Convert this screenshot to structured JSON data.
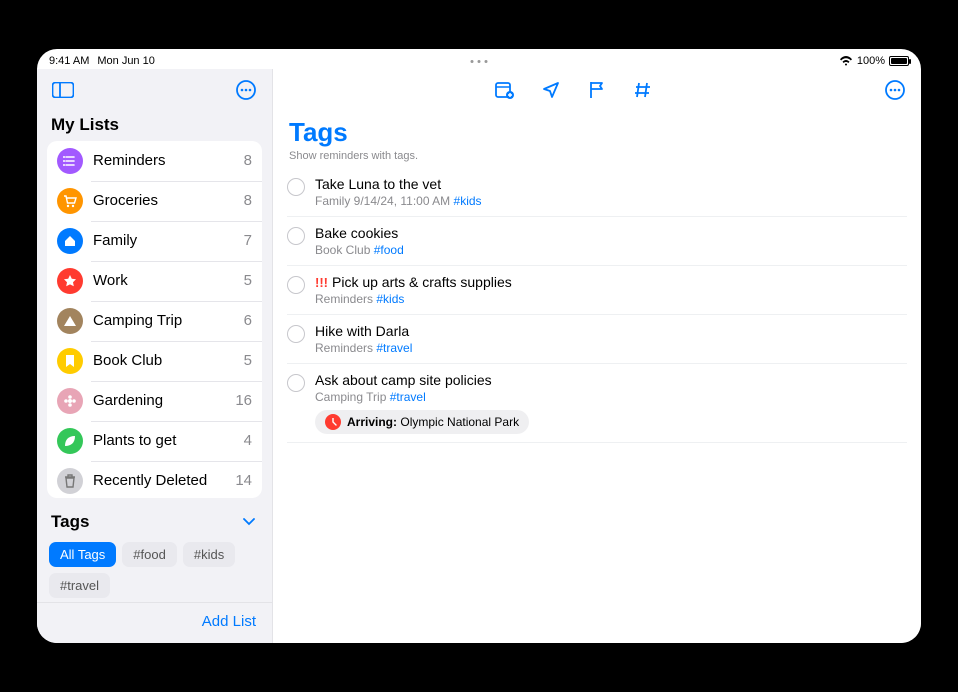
{
  "status": {
    "time": "9:41 AM",
    "date": "Mon Jun 10",
    "battery_pct": "100%"
  },
  "sidebar": {
    "my_lists_title": "My Lists",
    "lists": [
      {
        "name": "Reminders",
        "count": 8,
        "color": "#a259ff",
        "icon": "list"
      },
      {
        "name": "Groceries",
        "count": 8,
        "color": "#ff9500",
        "icon": "cart"
      },
      {
        "name": "Family",
        "count": 7,
        "color": "#007aff",
        "icon": "home"
      },
      {
        "name": "Work",
        "count": 5,
        "color": "#ff3b30",
        "icon": "star"
      },
      {
        "name": "Camping Trip",
        "count": 6,
        "color": "#a2845e",
        "icon": "tent"
      },
      {
        "name": "Book Club",
        "count": 5,
        "color": "#ffcc00",
        "icon": "bookmark"
      },
      {
        "name": "Gardening",
        "count": 16,
        "color": "#e8a5b6",
        "icon": "flower"
      },
      {
        "name": "Plants to get",
        "count": 4,
        "color": "#34c759",
        "icon": "leaf"
      },
      {
        "name": "Recently Deleted",
        "count": 14,
        "color": "#d1d1d6",
        "icon": "trash"
      }
    ],
    "tags_title": "Tags",
    "tags": [
      {
        "label": "All Tags",
        "selected": true
      },
      {
        "label": "#food",
        "selected": false
      },
      {
        "label": "#kids",
        "selected": false
      },
      {
        "label": "#travel",
        "selected": false
      }
    ],
    "add_list": "Add List"
  },
  "main": {
    "title": "Tags",
    "subtitle": "Show reminders with tags.",
    "reminders": [
      {
        "title": "Take Luna to the vet",
        "list": "Family",
        "extra": "9/14/24, 11:00 AM",
        "tag": "#kids"
      },
      {
        "title": "Bake cookies",
        "list": "Book Club",
        "extra": "",
        "tag": "#food"
      },
      {
        "title": "Pick up arts & crafts supplies",
        "priority": "!!!",
        "list": "Reminders",
        "extra": "",
        "tag": "#kids"
      },
      {
        "title": "Hike with Darla",
        "list": "Reminders",
        "extra": "",
        "tag": "#travel"
      },
      {
        "title": "Ask about camp site policies",
        "list": "Camping Trip",
        "extra": "",
        "tag": "#travel",
        "location_label": "Arriving:",
        "location_value": "Olympic National Park"
      }
    ]
  }
}
